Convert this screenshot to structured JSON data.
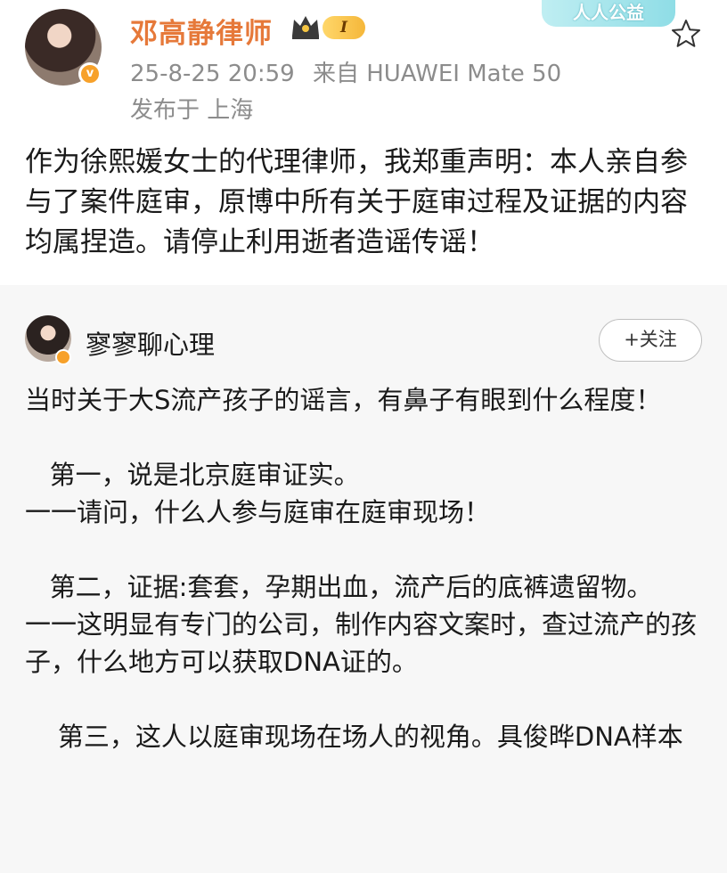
{
  "post": {
    "username": "邓高静律师",
    "level": "I",
    "timestamp": "25-8-25 20:59",
    "source": "来自 HUAWEI Mate 50",
    "location": "发布于 上海",
    "body": "作为徐熙媛女士的代理律师，我郑重声明：本人亲自参与了案件庭审，原博中所有关于庭审过程及证据的内容均属捏造。请停止利用逝者造谣传谣！"
  },
  "banner": {
    "text": "人人公益"
  },
  "repost": {
    "username": "寥寥聊心理",
    "follow_label": "+关注",
    "paragraphs": [
      "当时关于大S流产孩子的谣言，有鼻子有眼到什么程度！",
      "",
      "   第一，说是北京庭审证实。",
      "一一请问，什么人参与庭审在庭审现场！",
      "",
      "   第二，证据:套套，孕期出血，流产后的底裤遗留物。",
      "一一这明显有专门的公司，制作内容文案时，查过流产的孩子，什么地方可以获取DNA证的。",
      "",
      "    第三，这人以庭审现场在场人的视角。具俊晔DNA样本"
    ]
  },
  "colors": {
    "username": "#e6793a",
    "meta": "#8c8c8c",
    "badge": "#f7a12a"
  },
  "icons": {
    "crown": "crown-icon",
    "star": "star-icon",
    "verified": "verified-badge-icon"
  }
}
